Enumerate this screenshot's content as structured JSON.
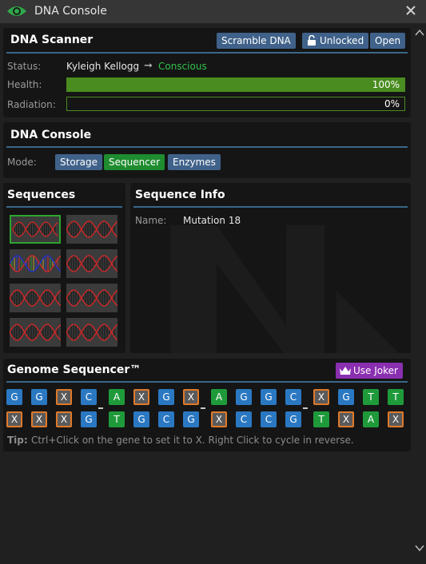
{
  "window": {
    "title": "DNA Console"
  },
  "scanner": {
    "title": "DNA Scanner",
    "buttons": {
      "scramble": "Scramble DNA",
      "lock": "Unlocked",
      "open": "Open"
    },
    "status_label": "Status:",
    "occupant": "Kyleigh Kellogg",
    "state": "Conscious",
    "health_label": "Health:",
    "health_value": 1.0,
    "health_text": "100%",
    "radiation_label": "Radiation:",
    "radiation_value": 0.0,
    "radiation_text": "0%"
  },
  "console": {
    "title": "DNA Console",
    "mode_label": "Mode:",
    "modes": [
      "Storage",
      "Sequencer",
      "Enzymes"
    ],
    "active_mode": "Sequencer"
  },
  "sequences": {
    "title": "Sequences",
    "count": 8,
    "selected_index": 0,
    "highlight_index": 2
  },
  "info": {
    "title": "Sequence Info",
    "name_label": "Name:",
    "name_value": "Mutation 18"
  },
  "genome": {
    "title": "Genome Sequencer™",
    "joker_label": "Use Joker",
    "top": [
      "G",
      "G",
      "X",
      "C",
      "A",
      "X",
      "G",
      "X",
      "A",
      "G",
      "G",
      "C",
      "X",
      "G",
      "T",
      "T"
    ],
    "bottom": [
      "X",
      "X",
      "X",
      "G",
      "T",
      "G",
      "C",
      "G",
      "X",
      "C",
      "C",
      "G",
      "T",
      "X",
      "A",
      "X"
    ],
    "tip_label": "Tip:",
    "tip_text": "Ctrl+Click on the gene to set it to X. Right Click to cycle in reverse."
  },
  "colors": {
    "accent_line": "#3a6788",
    "button_blue": "#40628a",
    "button_green": "#1e8c2f",
    "joker_purple": "#8a2fb0",
    "health_green": "#4a8c1f",
    "gene_A": "#1f9a3b",
    "gene_T": "#1f9a3b",
    "gene_G": "#2b78c2",
    "gene_C": "#2b78c2",
    "gene_X_border": "#e07a2a"
  }
}
